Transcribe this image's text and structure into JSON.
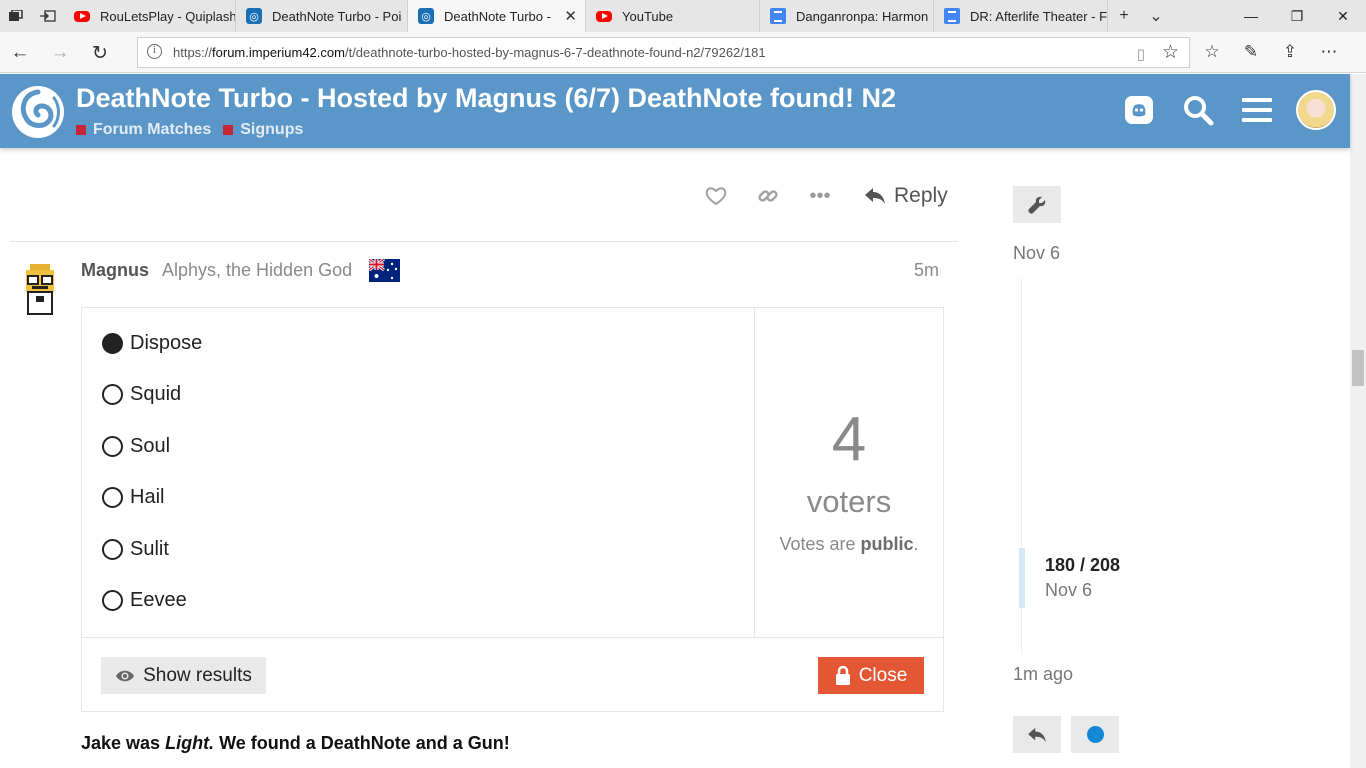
{
  "browser": {
    "tabs": [
      {
        "title": "RouLetsPlay - Quiplash",
        "icon": "youtube-icon"
      },
      {
        "title": "DeathNote Turbo - Poi",
        "icon": "imperium-icon"
      },
      {
        "title": "DeathNote Turbo -",
        "icon": "imperium-icon",
        "active": true
      },
      {
        "title": "YouTube",
        "icon": "youtube-icon"
      },
      {
        "title": "Danganronpa: Harmon",
        "icon": "docs-icon"
      },
      {
        "title": "DR: Afterlife Theater - F",
        "icon": "docs-icon"
      }
    ],
    "url_prefix": "https://",
    "url_domain": "forum.imperium42.com",
    "url_path": "/t/deathnote-turbo-hosted-by-magnus-6-7-deathnote-found-n2/79262/181"
  },
  "header": {
    "title": "DeathNote Turbo - Hosted by Magnus (6/7) DeathNote found! N2",
    "categories": [
      "Forum Matches",
      "Signups"
    ],
    "category_color": "#c62636",
    "brand_color": "#5a97c8"
  },
  "prev_post": {
    "reply_label": "Reply"
  },
  "post": {
    "username": "Magnus",
    "user_title": "Alphys, the Hidden God",
    "age": "5m",
    "poll": {
      "options": [
        {
          "label": "Dispose",
          "selected": true
        },
        {
          "label": "Squid",
          "selected": false
        },
        {
          "label": "Soul",
          "selected": false
        },
        {
          "label": "Hail",
          "selected": false
        },
        {
          "label": "Sulit",
          "selected": false
        },
        {
          "label": "Eevee",
          "selected": false
        }
      ],
      "voters_count": "4",
      "voters_label": "voters",
      "votes_prefix": "Votes are ",
      "votes_mode": "public",
      "votes_suffix": ".",
      "show_results_label": "Show results",
      "close_label": "Close",
      "close_color": "#e45735"
    },
    "body_prefix": "Jake was ",
    "body_emph": "Light.",
    "body_suffix": " We found a DeathNote and a Gun!"
  },
  "timeline": {
    "start_date": "Nov 6",
    "position": "180 / 208",
    "position_date": "Nov 6",
    "end_label": "1m ago"
  }
}
